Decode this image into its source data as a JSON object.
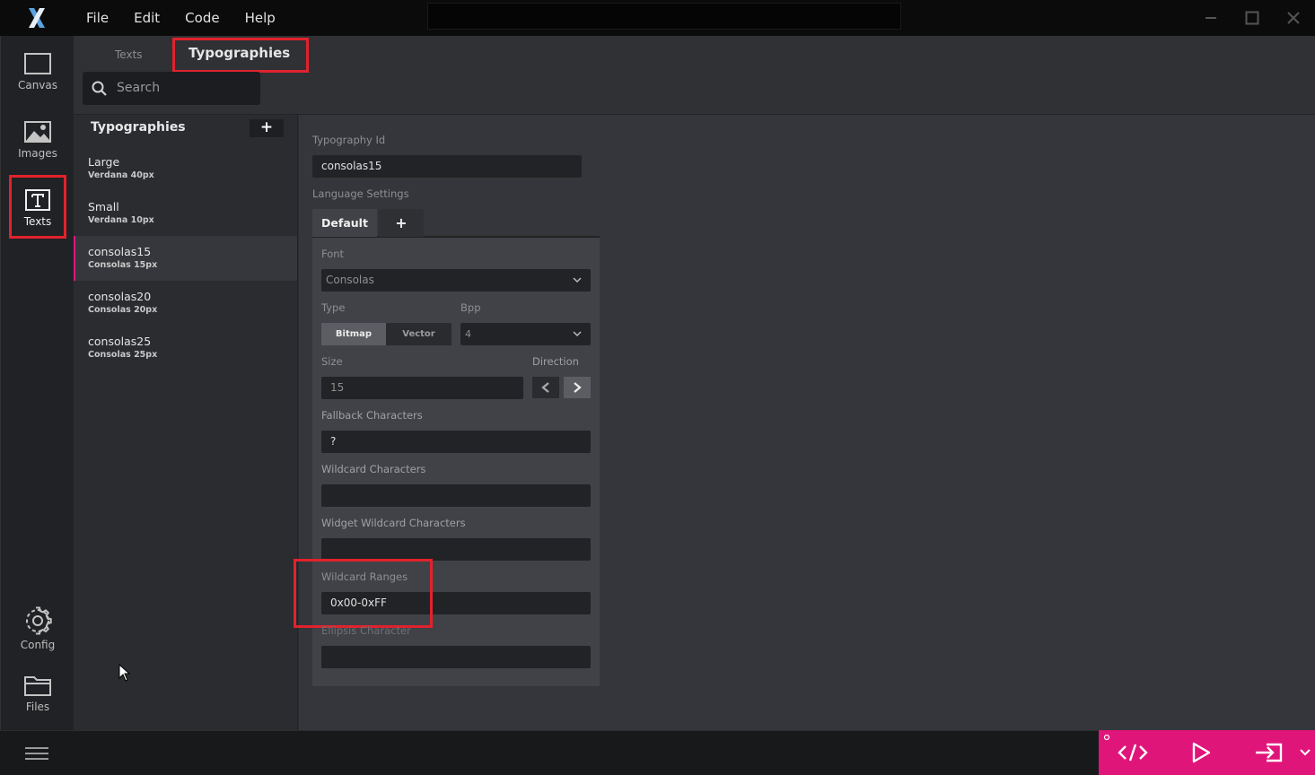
{
  "menu": [
    "File",
    "Edit",
    "Code",
    "Help"
  ],
  "rail": {
    "canvas": "Canvas",
    "images": "Images",
    "texts": "Texts",
    "config": "Config",
    "files": "Files"
  },
  "tabs": {
    "texts": "Texts",
    "typographies": "Typographies"
  },
  "search": {
    "placeholder": "Search"
  },
  "typographies": {
    "title": "Typographies",
    "add": "+",
    "items": [
      {
        "name": "Large",
        "sub": "Verdana  40px"
      },
      {
        "name": "Small",
        "sub": "Verdana  10px"
      },
      {
        "name": "consolas15",
        "sub": "Consolas  15px"
      },
      {
        "name": "consolas20",
        "sub": "Consolas  20px"
      },
      {
        "name": "consolas25",
        "sub": "Consolas  25px"
      }
    ]
  },
  "details": {
    "typography_id_label": "Typography Id",
    "typography_id": "consolas15",
    "language_settings_label": "Language Settings",
    "lang_tab_default": "Default",
    "lang_tab_add": "+",
    "font_label": "Font",
    "font_value": "Consolas",
    "type_label": "Type",
    "type_bitmap": "Bitmap",
    "type_vector": "Vector",
    "bpp_label": "Bpp",
    "bpp_value": "4",
    "size_label": "Size",
    "size_value": "15",
    "direction_label": "Direction",
    "fallback_label": "Fallback Characters",
    "fallback_value": "?",
    "wildcard_label": "Wildcard Characters",
    "wildcard_value": "",
    "widget_wildcard_label": "Widget Wildcard Characters",
    "widget_wildcard_value": "",
    "wildcard_ranges_label": "Wildcard Ranges",
    "wildcard_ranges_value": "0x00-0xFF",
    "ellipsis_label": "Ellipsis Character",
    "ellipsis_value": ""
  },
  "colors": {
    "accent": "#e0157a",
    "highlight": "#e1222d",
    "logo": "#5aa3e0"
  }
}
